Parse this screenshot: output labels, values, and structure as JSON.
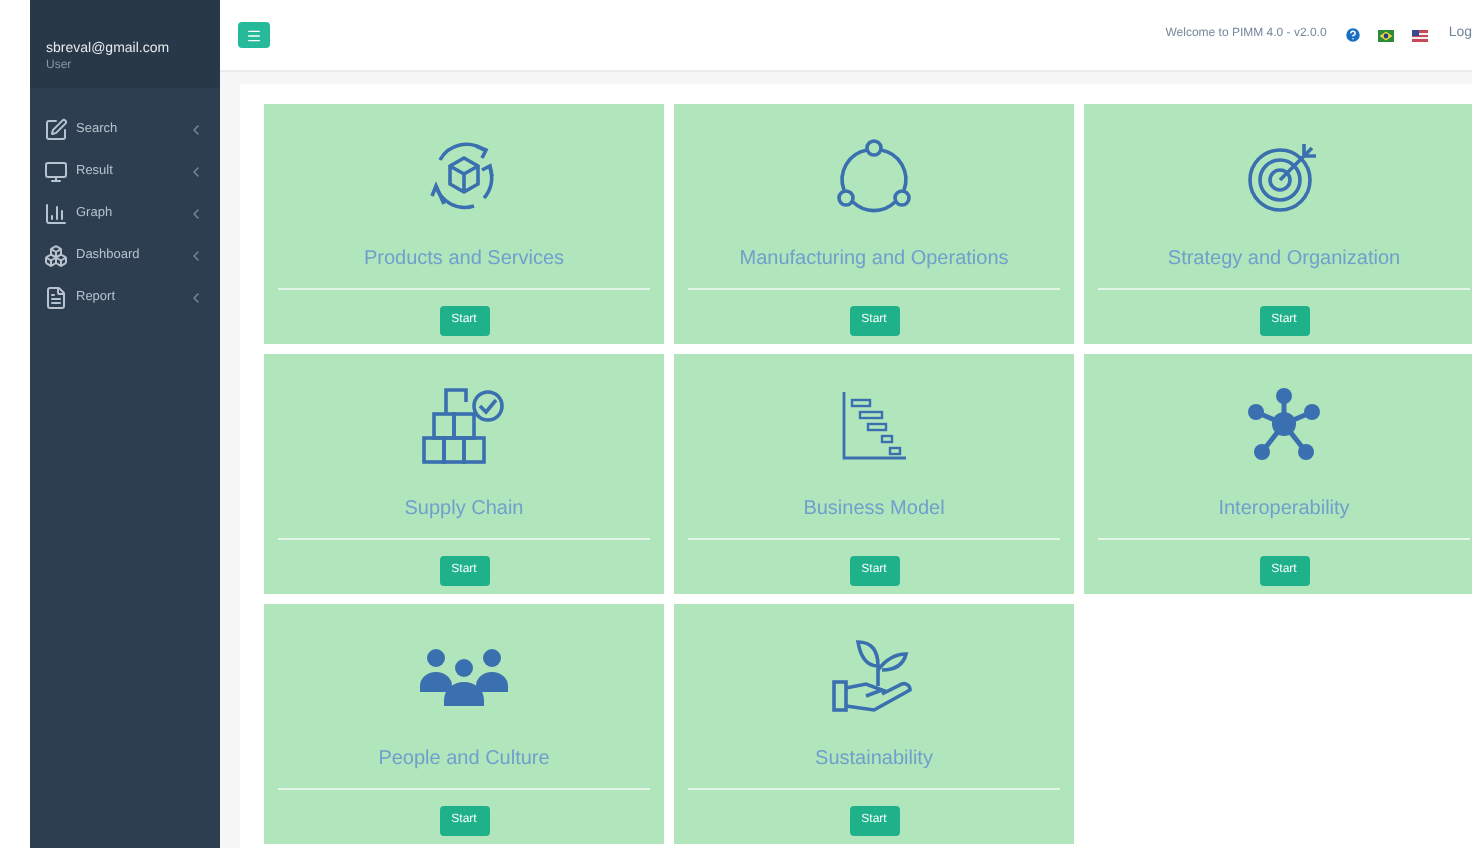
{
  "sidebar": {
    "user": {
      "email": "sbreval@gmail.com",
      "role": "User"
    },
    "items": [
      {
        "label": "Search",
        "kind": "edit"
      },
      {
        "label": "Result",
        "kind": "monitor"
      },
      {
        "label": "Graph",
        "kind": "chart"
      },
      {
        "label": "Dashboard",
        "kind": "cubes"
      },
      {
        "label": "Report",
        "kind": "file"
      }
    ]
  },
  "topbar": {
    "welcome": "Welcome to PIMM 4.0 - v2.0.0",
    "logout": "Log"
  },
  "cards": [
    {
      "title": "Products and Services",
      "kind": "box-cycle",
      "button": "Start"
    },
    {
      "title": "Manufacturing and Operations",
      "kind": "cycle-nodes",
      "button": "Start"
    },
    {
      "title": "Strategy and Organization",
      "kind": "target",
      "button": "Start"
    },
    {
      "title": "Supply Chain",
      "kind": "boxes-check",
      "button": "Start"
    },
    {
      "title": "Business Model",
      "kind": "gantt",
      "button": "Start"
    },
    {
      "title": "Interoperability",
      "kind": "network",
      "button": "Start"
    },
    {
      "title": "People and Culture",
      "kind": "people",
      "button": "Start"
    },
    {
      "title": "Sustainability",
      "kind": "plant-hand",
      "button": "Start"
    }
  ]
}
